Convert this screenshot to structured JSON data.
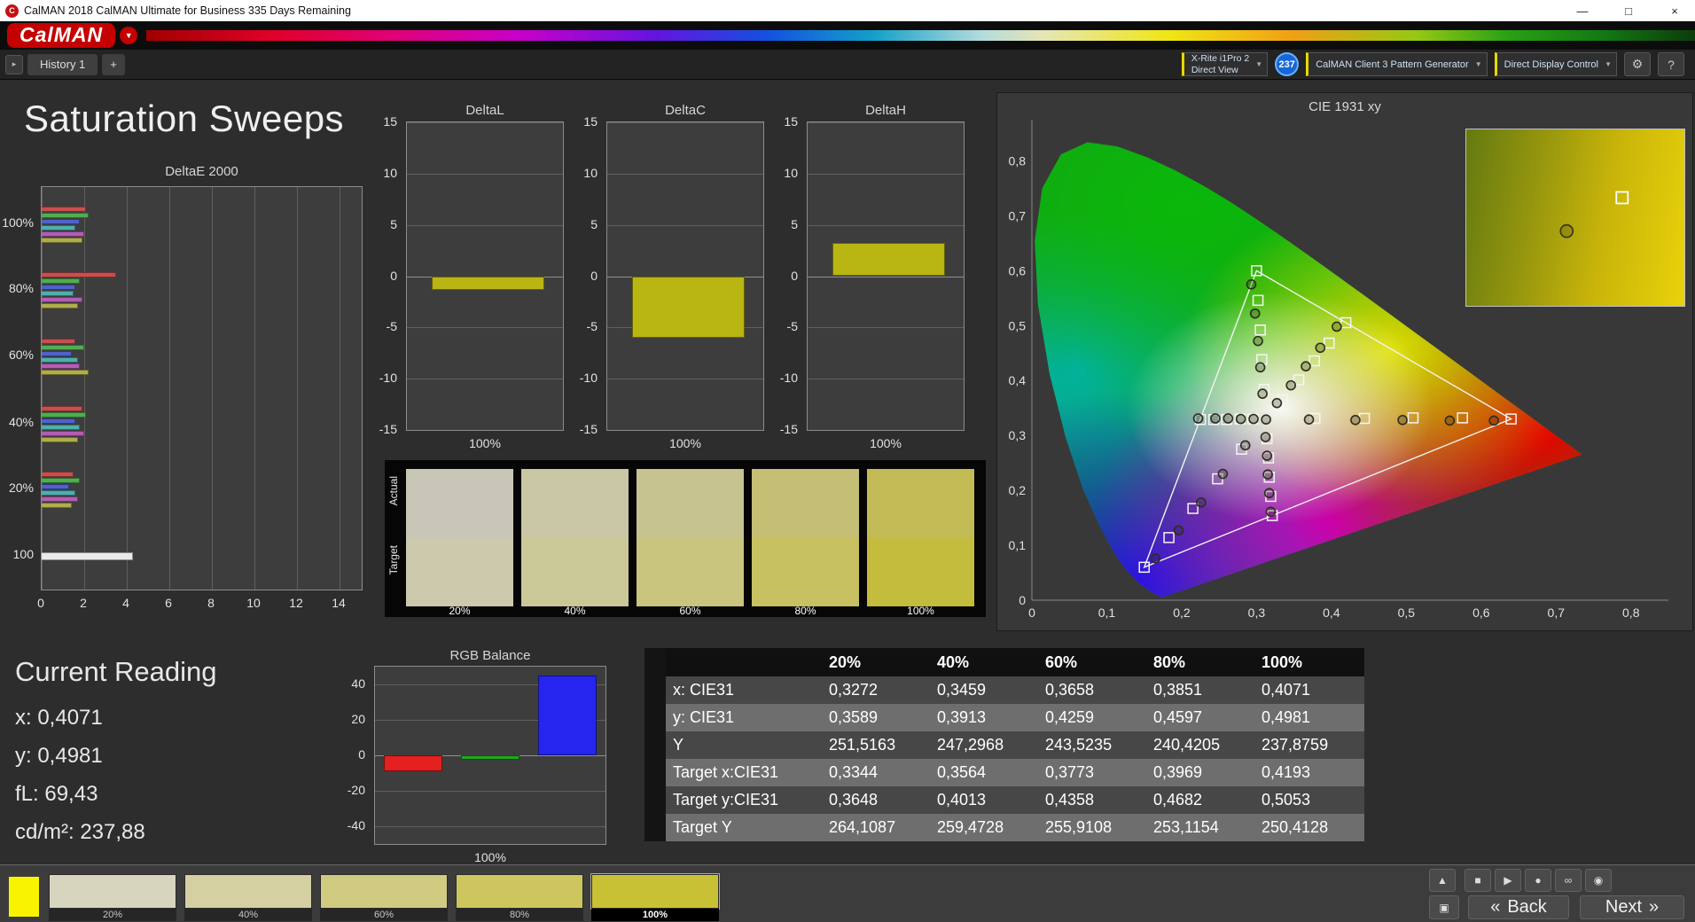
{
  "titlebar": {
    "title": "CalMAN 2018 CalMAN Ultimate for Business 335 Days Remaining",
    "controls": {
      "minimize": "—",
      "maximize": "□",
      "close": "×"
    }
  },
  "brand": {
    "logo": "CalMAN"
  },
  "tabs": {
    "history": "History 1",
    "add": "+"
  },
  "toolbar": {
    "meter_line1": "X-Rite i1Pro 2",
    "meter_line2": "Direct View",
    "meter_count": "237",
    "source": "CalMAN Client 3 Pattern Generator",
    "display": "Direct Display Control",
    "help": "?"
  },
  "icons": {
    "app": "C",
    "tab_arrow": "▸",
    "caret": "▼",
    "settings": "⚙",
    "up": "▲",
    "stop": "■",
    "play": "▶",
    "record": "●",
    "loop": "∞",
    "eye": "◉",
    "window": "▣",
    "back_chevron": "«",
    "next_chevron": "»"
  },
  "page": {
    "title": "Saturation Sweeps"
  },
  "current_reading": {
    "title": "Current Reading",
    "x": "x: 0,4071",
    "y": "y: 0,4981",
    "fl": "fL: 69,43",
    "cdm2": "cd/m²: 237,88"
  },
  "chart_data": {
    "deltaE2000": {
      "type": "bar",
      "orientation": "horizontal",
      "title": "DeltaE 2000",
      "xlim": [
        0,
        14
      ],
      "xticks": [
        0,
        2,
        4,
        6,
        8,
        10,
        12,
        14
      ],
      "series_colors": [
        "#c94f4f",
        "#4fae4f",
        "#5062c9",
        "#4faeae",
        "#b45cb4",
        "#b0ae4a"
      ],
      "groups": [
        {
          "label": "100%",
          "values": [
            2.1,
            2.2,
            1.8,
            1.6,
            2.0,
            1.9
          ]
        },
        {
          "label": "80%",
          "values": [
            3.5,
            1.8,
            1.6,
            1.5,
            1.9,
            1.7
          ]
        },
        {
          "label": "60%",
          "values": [
            1.6,
            2.0,
            1.4,
            1.7,
            1.8,
            2.2
          ]
        },
        {
          "label": "40%",
          "values": [
            1.9,
            2.1,
            1.6,
            1.8,
            2.0,
            1.7
          ]
        },
        {
          "label": "20%",
          "values": [
            1.5,
            1.8,
            1.3,
            1.6,
            1.7,
            1.4
          ]
        },
        {
          "label": "100",
          "values": [
            4.3
          ],
          "colors": [
            "#e9e9e9"
          ]
        }
      ]
    },
    "deltaL": {
      "type": "bar",
      "title": "DeltaL",
      "ylim": [
        -15,
        15
      ],
      "yticks": [
        15,
        10,
        5,
        0,
        -5,
        -10,
        -15
      ],
      "xlabel": "100%",
      "value": -1.3,
      "bar_color": "#b9b513"
    },
    "deltaC": {
      "type": "bar",
      "title": "DeltaC",
      "ylim": [
        -15,
        15
      ],
      "yticks": [
        15,
        10,
        5,
        0,
        -5,
        -10,
        -15
      ],
      "xlabel": "100%",
      "value": -6.0,
      "bar_color": "#b9b513"
    },
    "deltaH": {
      "type": "bar",
      "title": "DeltaH",
      "ylim": [
        -15,
        15
      ],
      "yticks": [
        15,
        10,
        5,
        0,
        -5,
        -10,
        -15
      ],
      "xlabel": "100%",
      "value": 3.2,
      "bar_color": "#b9b513"
    },
    "rgb_balance": {
      "type": "bar",
      "title": "RGB Balance",
      "ylim": [
        -50,
        50
      ],
      "yticks": [
        40,
        20,
        0,
        -20,
        -40
      ],
      "xlabel": "100%",
      "bars": [
        {
          "name": "Red",
          "color": "#e42020",
          "value": -9
        },
        {
          "name": "Green",
          "color": "#1fa51f",
          "value": -2.5
        },
        {
          "name": "Blue",
          "color": "#2525ef",
          "value": 45
        }
      ]
    },
    "cie1931": {
      "type": "scatter",
      "title": "CIE 1931 xy",
      "xlim": [
        0,
        0.8
      ],
      "ylim": [
        0,
        0.8
      ],
      "xticks": [
        "0",
        "0,1",
        "0,2",
        "0,3",
        "0,4",
        "0,5",
        "0,6",
        "0,7",
        "0,8"
      ],
      "yticks": [
        "0",
        "0,1",
        "0,2",
        "0,3",
        "0,4",
        "0,5",
        "0,6",
        "0,7",
        "0,8"
      ],
      "gamut_triangle": [
        [
          0.64,
          0.33
        ],
        [
          0.3,
          0.6
        ],
        [
          0.15,
          0.06
        ]
      ],
      "target_points": [
        [
          0.3344,
          0.3648
        ],
        [
          0.3564,
          0.4013
        ],
        [
          0.3773,
          0.4358
        ],
        [
          0.3969,
          0.4682
        ],
        [
          0.4193,
          0.5053
        ],
        [
          0.378,
          0.331
        ],
        [
          0.444,
          0.331
        ],
        [
          0.509,
          0.332
        ],
        [
          0.575,
          0.332
        ],
        [
          0.64,
          0.33
        ],
        [
          0.31,
          0.384
        ],
        [
          0.307,
          0.438
        ],
        [
          0.305,
          0.492
        ],
        [
          0.302,
          0.546
        ],
        [
          0.3,
          0.6
        ],
        [
          0.28,
          0.275
        ],
        [
          0.248,
          0.221
        ],
        [
          0.215,
          0.167
        ],
        [
          0.183,
          0.114
        ],
        [
          0.15,
          0.06
        ],
        [
          0.295,
          0.33
        ],
        [
          0.278,
          0.33
        ],
        [
          0.26,
          0.329
        ],
        [
          0.243,
          0.329
        ],
        [
          0.225,
          0.329
        ],
        [
          0.314,
          0.294
        ],
        [
          0.316,
          0.259
        ],
        [
          0.317,
          0.224
        ],
        [
          0.319,
          0.189
        ],
        [
          0.321,
          0.154
        ]
      ],
      "measured_points": [
        [
          0.3272,
          0.3589
        ],
        [
          0.3459,
          0.3913
        ],
        [
          0.3658,
          0.4259
        ],
        [
          0.3851,
          0.4597
        ],
        [
          0.4071,
          0.4981
        ],
        [
          0.37,
          0.329
        ],
        [
          0.432,
          0.328
        ],
        [
          0.495,
          0.328
        ],
        [
          0.558,
          0.327
        ],
        [
          0.617,
          0.327
        ],
        [
          0.308,
          0.376
        ],
        [
          0.305,
          0.424
        ],
        [
          0.302,
          0.472
        ],
        [
          0.298,
          0.522
        ],
        [
          0.293,
          0.575
        ],
        [
          0.285,
          0.282
        ],
        [
          0.255,
          0.23
        ],
        [
          0.226,
          0.178
        ],
        [
          0.196,
          0.127
        ],
        [
          0.165,
          0.076
        ],
        [
          0.296,
          0.33
        ],
        [
          0.279,
          0.33
        ],
        [
          0.262,
          0.331
        ],
        [
          0.245,
          0.331
        ],
        [
          0.222,
          0.331
        ],
        [
          0.312,
          0.297
        ],
        [
          0.314,
          0.263
        ],
        [
          0.315,
          0.229
        ],
        [
          0.317,
          0.195
        ],
        [
          0.319,
          0.161
        ],
        [
          0.3127,
          0.329
        ]
      ],
      "inset": {
        "xrange": [
          0.385,
          0.433
        ],
        "yrange": [
          0.482,
          0.52
        ],
        "square": [
          0.4193,
          0.5053
        ],
        "circle": [
          0.4071,
          0.4981
        ]
      }
    }
  },
  "swatches": {
    "actual_label": "Actual",
    "target_label": "Target",
    "items": [
      {
        "label": "20%",
        "actual": "#c8c7b7",
        "target": "#ccc9ad"
      },
      {
        "label": "40%",
        "actual": "#c8c6a4",
        "target": "#cbc898"
      },
      {
        "label": "60%",
        "actual": "#c7c390",
        "target": "#c9c47e"
      },
      {
        "label": "80%",
        "actual": "#c5bf75",
        "target": "#c7c162"
      },
      {
        "label": "100%",
        "actual": "#c2bb55",
        "target": "#c4bc3c"
      }
    ]
  },
  "table": {
    "headers": [
      "20%",
      "40%",
      "60%",
      "80%",
      "100%"
    ],
    "rows": [
      {
        "label": "x: CIE31",
        "values": [
          "0,3272",
          "0,3459",
          "0,3658",
          "0,3851",
          "0,4071"
        ]
      },
      {
        "label": "y: CIE31",
        "values": [
          "0,3589",
          "0,3913",
          "0,4259",
          "0,4597",
          "0,4981"
        ]
      },
      {
        "label": "Y",
        "values": [
          "251,5163",
          "247,2968",
          "243,5235",
          "240,4205",
          "237,8759"
        ]
      },
      {
        "label": "Target x:CIE31",
        "values": [
          "0,3344",
          "0,3564",
          "0,3773",
          "0,3969",
          "0,4193"
        ]
      },
      {
        "label": "Target y:CIE31",
        "values": [
          "0,3648",
          "0,4013",
          "0,4358",
          "0,4682",
          "0,5053"
        ]
      },
      {
        "label": "Target Y",
        "values": [
          "264,1087",
          "259,4728",
          "255,9108",
          "253,1154",
          "250,4128"
        ]
      }
    ]
  },
  "bottom_bar": {
    "current_patch_color": "#f8f400",
    "patches": [
      {
        "label": "20%",
        "color": "#d8d5bf",
        "selected": false
      },
      {
        "label": "40%",
        "color": "#d4d0a2",
        "selected": false
      },
      {
        "label": "60%",
        "color": "#d0cb81",
        "selected": false
      },
      {
        "label": "80%",
        "color": "#cdc65e",
        "selected": false
      },
      {
        "label": "100%",
        "color": "#c9c135",
        "selected": true
      }
    ],
    "back": "Back",
    "next": "Next"
  }
}
